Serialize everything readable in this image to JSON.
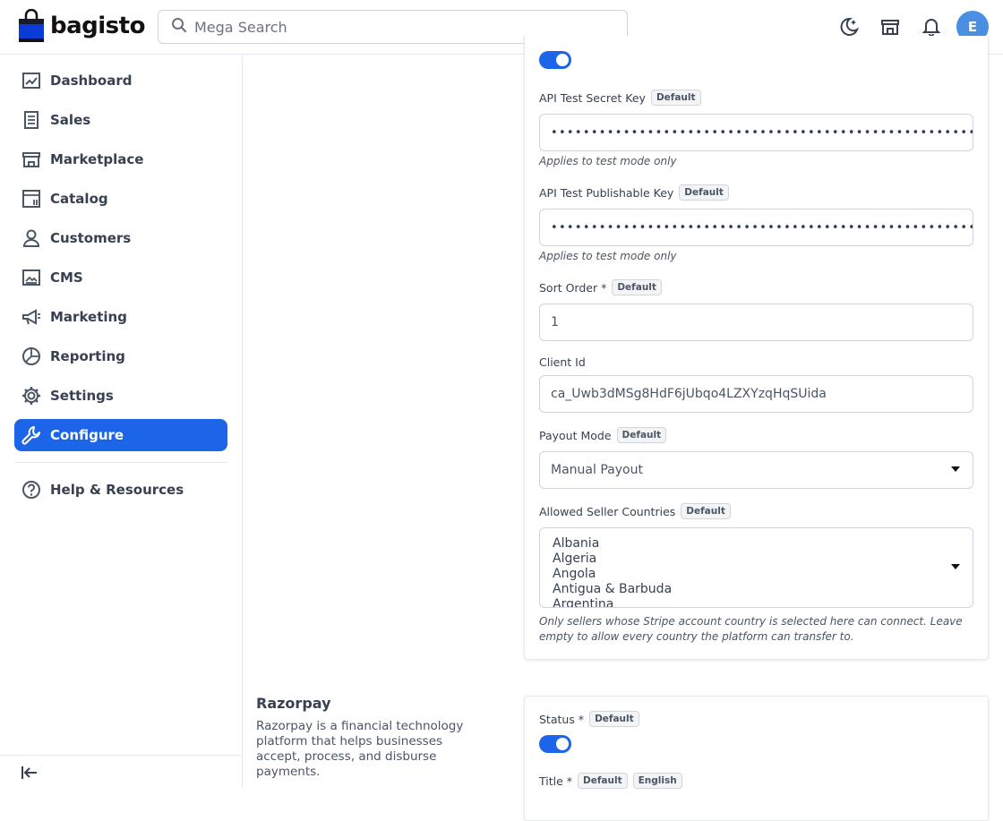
{
  "header": {
    "logo_text": "bagisto",
    "search_placeholder": "Mega Search",
    "avatar_initial": "E",
    "icons": [
      "moon-icon",
      "store-icon",
      "bell-icon"
    ]
  },
  "sidebar": {
    "items": [
      {
        "label": "Dashboard",
        "icon": "dashboard-icon"
      },
      {
        "label": "Sales",
        "icon": "sales-icon"
      },
      {
        "label": "Marketplace",
        "icon": "store-icon"
      },
      {
        "label": "Catalog",
        "icon": "catalog-icon"
      },
      {
        "label": "Customers",
        "icon": "user-icon"
      },
      {
        "label": "CMS",
        "icon": "cms-icon"
      },
      {
        "label": "Marketing",
        "icon": "megaphone-icon"
      },
      {
        "label": "Reporting",
        "icon": "pie-chart-icon"
      },
      {
        "label": "Settings",
        "icon": "gear-icon"
      },
      {
        "label": "Configure",
        "icon": "wrench-icon",
        "active": true
      }
    ],
    "help": {
      "label": "Help & Resources",
      "icon": "help-icon"
    }
  },
  "stripe": {
    "api_test_secret_key": {
      "label": "API Test Secret Key",
      "badge": "Default",
      "value": "••••••••••••••••••••••••••••••••••••••••••••••••••••••••••••••",
      "hint": "Applies to test mode only"
    },
    "api_test_publishable_key": {
      "label": "API Test Publishable Key",
      "badge": "Default",
      "value": "••••••••••••••••••••••••••••••••••••••••••••••••••••••••••••••",
      "hint": "Applies to test mode only"
    },
    "sort_order": {
      "label": "Sort Order *",
      "badge": "Default",
      "value": "1"
    },
    "client_id": {
      "label": "Client Id",
      "value": "ca_Uwb3dMSg8HdF6jUbqo4LZXYzqHqSUida"
    },
    "payout_mode": {
      "label": "Payout Mode",
      "badge": "Default",
      "value": "Manual Payout"
    },
    "allowed_seller_countries": {
      "label": "Allowed Seller Countries",
      "badge": "Default",
      "options": [
        "Albania",
        "Algeria",
        "Angola",
        "Antigua & Barbuda",
        "Argentina"
      ],
      "hint_line1": "Only sellers whose Stripe account country is selected here can connect. Leave",
      "hint_line2": "empty to allow every country the platform can transfer to."
    }
  },
  "razorpay": {
    "title": "Razorpay",
    "description": "Razorpay is a financial technology platform that helps businesses accept, process, and disburse payments.",
    "status": {
      "label": "Status *",
      "badge": "Default"
    },
    "title_field": {
      "label": "Title *",
      "badge": "Default",
      "badge2": "English"
    }
  },
  "colors": {
    "accent": "#1d65e8",
    "avatar": "#4a90e2"
  }
}
